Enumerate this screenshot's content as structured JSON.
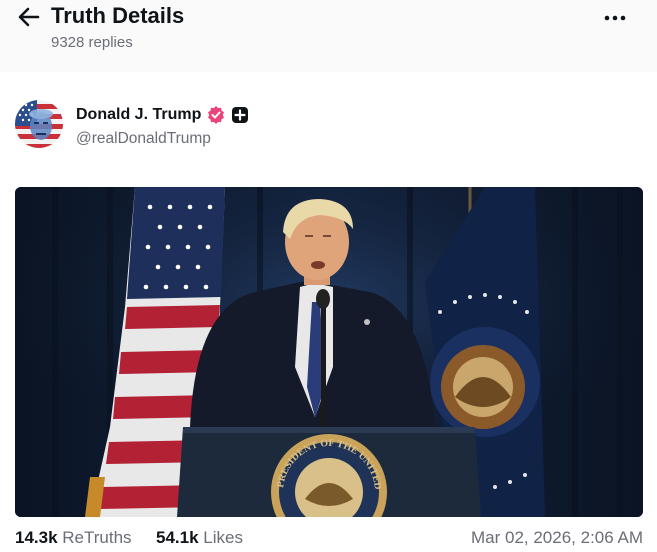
{
  "header": {
    "title": "Truth Details",
    "replies": "9328 replies"
  },
  "post": {
    "author": {
      "name": "Donald J. Trump",
      "handle": "@realDonaldTrump",
      "verified_badge_color": "#e9457a"
    },
    "media": {
      "alt_icon": "video-still",
      "seal_text": "PRESIDENT OF THE UNITED"
    },
    "stats": {
      "retruths_count": "14.3k",
      "retruths_label": "ReTruths",
      "likes_count": "54.1k",
      "likes_label": "Likes",
      "timestamp": "Mar 02, 2026, 2:06 AM"
    }
  },
  "colors": {
    "text_primary": "#0f1419",
    "text_secondary": "#6b6e77",
    "header_bg": "#fafafa"
  }
}
